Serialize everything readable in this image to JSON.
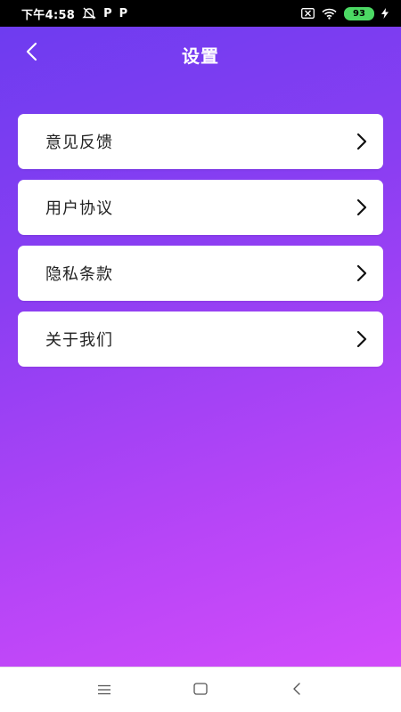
{
  "status_bar": {
    "time": "下午4:58",
    "battery": "93",
    "icons": [
      "alarm-off-icon",
      "p-app-icon",
      "p-app-icon",
      "sim-x-icon",
      "wifi-icon",
      "battery-icon",
      "charging-icon"
    ],
    "p_label": "P"
  },
  "header": {
    "title": "设置",
    "back_icon": "chevron-left-icon"
  },
  "menu": {
    "items": [
      {
        "label": "意见反馈",
        "icon": "chevron-right-icon"
      },
      {
        "label": "用户协议",
        "icon": "chevron-right-icon"
      },
      {
        "label": "隐私条款",
        "icon": "chevron-right-icon"
      },
      {
        "label": "关于我们",
        "icon": "chevron-right-icon"
      }
    ]
  },
  "nav_bar": {
    "icons": [
      "menu-icon",
      "home-square-icon",
      "back-triangle-icon"
    ]
  },
  "colors": {
    "gradient_start": "#6b3cf0",
    "gradient_end": "#d84dfb",
    "card": "#ffffff",
    "text": "#222222"
  }
}
